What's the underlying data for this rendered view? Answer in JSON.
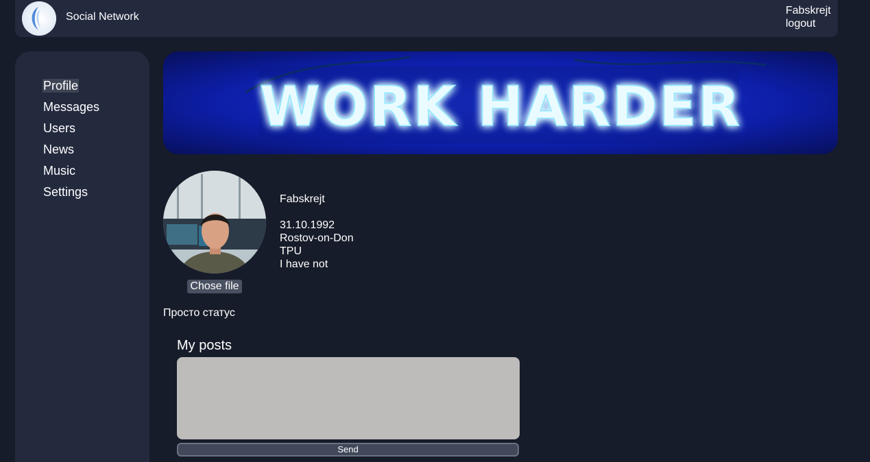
{
  "header": {
    "app_title": "Social Network",
    "username": "Fabskrejt",
    "logout_label": "logout"
  },
  "sidebar": {
    "items": [
      {
        "label": "Profile",
        "active": true
      },
      {
        "label": "Messages"
      },
      {
        "label": "Users"
      },
      {
        "label": "News"
      },
      {
        "label": "Music"
      },
      {
        "label": "Settings"
      }
    ]
  },
  "banner": {
    "text": "WORK HARDER",
    "colors": {
      "neon": "#e9fbff",
      "glow": "#3b67ff",
      "background": "#0a1a9a"
    }
  },
  "profile": {
    "chose_file_label": "Chose file",
    "name": "Fabskrejt",
    "birth_date": "31.10.1992",
    "city": "Rostov-on-Don",
    "education": "TPU",
    "extra": "I have not",
    "status": "Просто статус"
  },
  "posts": {
    "title": "My posts",
    "input_value": "",
    "send_label": "Send"
  },
  "colors": {
    "page_bg": "#171c2a",
    "panel_bg": "#232a3e",
    "input_bg": "#bdbcbb",
    "button_bg": "#414859"
  }
}
